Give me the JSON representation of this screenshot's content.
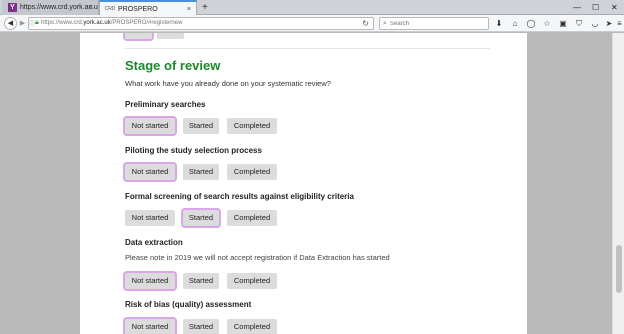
{
  "browser": {
    "tabs": [
      {
        "title": "https://www.crd.york.ac.u...",
        "favicon": "Y",
        "close": "×"
      },
      {
        "title": "PROSPERO",
        "favicon": "CRD",
        "close": "×"
      }
    ],
    "new_tab": "+",
    "window_controls": {
      "minimize": "—",
      "maximize": "☐",
      "close": "✕"
    },
    "back": "◀",
    "url_prefix": "https://www.crd.",
    "url_domain": "york.ac.uk",
    "url_path": "/PROSPERO/#registernew",
    "reload": "↻",
    "search_placeholder": "Search",
    "toolbar_icons": [
      "download-icon",
      "home-icon",
      "chat-icon",
      "star-icon",
      "clipboard-icon",
      "shield-icon",
      "pocket-icon",
      "send-icon",
      "menu-icon"
    ]
  },
  "page": {
    "heading": "Stage of review",
    "subtitle": "What work have you already done on your systematic review?",
    "data_extraction_note": "Please note in 2019 we will not accept registration if Data Extraction has started",
    "options": [
      "Not started",
      "Started",
      "Completed"
    ],
    "questions": [
      {
        "label": "Preliminary searches",
        "selected": "Not started"
      },
      {
        "label": "Piloting the study selection process",
        "selected": "Not started"
      },
      {
        "label": "Formal screening of search results against eligibility criteria",
        "selected": "Started"
      },
      {
        "label": "Data extraction",
        "selected": "Not started"
      },
      {
        "label": "Risk of bias (quality) assessment",
        "selected": "Not started"
      }
    ],
    "accent_color": "#1a8a2a",
    "selected_glow": "#dba6e8"
  }
}
